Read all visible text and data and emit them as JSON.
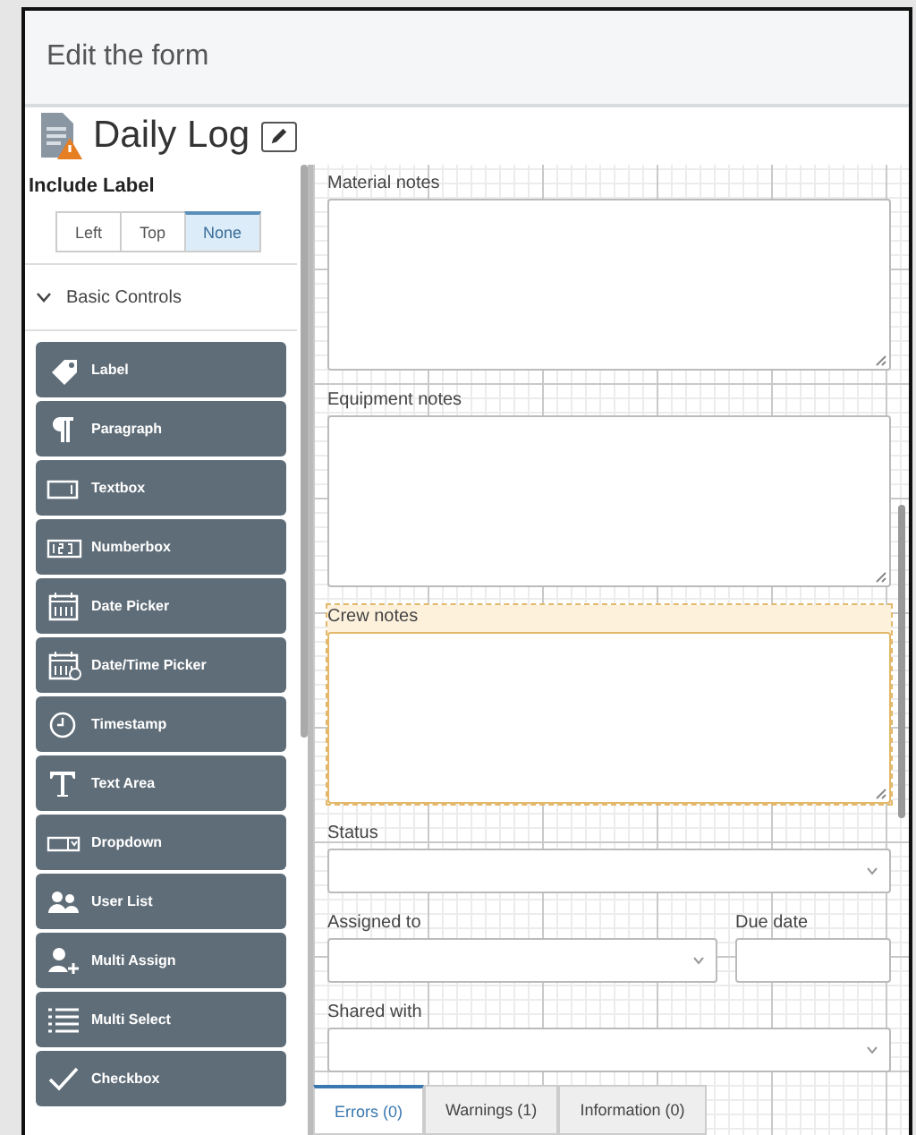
{
  "header": {
    "title": "Edit the form"
  },
  "form": {
    "title": "Daily Log"
  },
  "sidebar": {
    "include_label": {
      "title": "Include Label",
      "options": [
        {
          "label": "Left",
          "selected": false
        },
        {
          "label": "Top",
          "selected": false
        },
        {
          "label": "None",
          "selected": true
        }
      ]
    },
    "section": {
      "title": "Basic Controls",
      "expanded": true
    },
    "controls": [
      {
        "label": "Label",
        "kind": "label"
      },
      {
        "label": "Paragraph",
        "kind": "paragraph"
      },
      {
        "label": "Textbox",
        "kind": "textbox"
      },
      {
        "label": "Numberbox",
        "kind": "numberbox"
      },
      {
        "label": "Date Picker",
        "kind": "date"
      },
      {
        "label": "Date/Time Picker",
        "kind": "datetime"
      },
      {
        "label": "Timestamp",
        "kind": "timestamp"
      },
      {
        "label": "Text Area",
        "kind": "textarea"
      },
      {
        "label": "Dropdown",
        "kind": "dropdown"
      },
      {
        "label": "User List",
        "kind": "userlist"
      },
      {
        "label": "Multi Assign",
        "kind": "multiassign"
      },
      {
        "label": "Multi Select",
        "kind": "multiselect"
      },
      {
        "label": "Checkbox",
        "kind": "checkbox"
      }
    ]
  },
  "canvas": {
    "rows": [
      [
        {
          "label": "Material notes",
          "kind": "textarea",
          "selected": false
        }
      ],
      [
        {
          "label": "Equipment notes",
          "kind": "textarea",
          "selected": false
        }
      ],
      [
        {
          "label": "Crew notes",
          "kind": "textarea",
          "selected": true
        }
      ],
      [
        {
          "label": "Status",
          "kind": "dropdown",
          "selected": false
        }
      ],
      [
        {
          "label": "Assigned to",
          "kind": "dropdown",
          "selected": false
        },
        {
          "label": "Due date",
          "kind": "textbox",
          "selected": false
        }
      ],
      [
        {
          "label": "Shared with",
          "kind": "dropdown",
          "selected": false
        }
      ]
    ]
  },
  "bottom_tabs": [
    {
      "label": "Errors (0)",
      "selected": true
    },
    {
      "label": "Warnings (1)",
      "selected": false
    },
    {
      "label": "Information (0)",
      "selected": false
    }
  ]
}
